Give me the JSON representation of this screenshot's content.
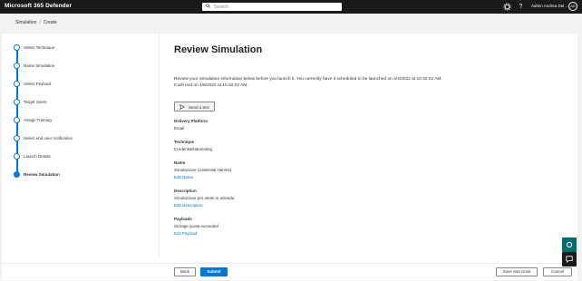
{
  "header": {
    "app_name": "Microsoft 365 Defender",
    "search_placeholder": "Search",
    "user_name": "Admin Andrea Del...",
    "avatar_initials": "AD",
    "icons": [
      "search-icon",
      "gear-icon",
      "help-icon"
    ]
  },
  "breadcrumb": {
    "items": [
      "Simulation",
      "Create"
    ],
    "separator": "/"
  },
  "steps": [
    {
      "label": "Select Technique",
      "state": "completed"
    },
    {
      "label": "Name Simulation",
      "state": "completed"
    },
    {
      "label": "Select Payload",
      "state": "completed"
    },
    {
      "label": "Target Users",
      "state": "completed"
    },
    {
      "label": "Assign Training",
      "state": "completed"
    },
    {
      "label": "Select end user notification",
      "state": "completed"
    },
    {
      "label": "Launch Details",
      "state": "completed"
    },
    {
      "label": "Review Simulation",
      "state": "current"
    }
  ],
  "main": {
    "title": "Review Simulation",
    "intro_line1": "Review your Simulation information below before you launch it. You currently have it scheduled to be launched on 4/4/2022 at 10:32:02 AM.",
    "intro_line2": "It will end on 4/6/2022 at 10:32:02 AM.",
    "send_test_label": "Send a test",
    "fields": {
      "delivery_platform": {
        "heading": "Delivery Platform",
        "value": "Email"
      },
      "technique": {
        "heading": "Technique",
        "value": "CredentialHarvesting"
      },
      "name": {
        "heading": "Name",
        "value": "Simulazione Credential Harvest",
        "edit_label": "Edit Name"
      },
      "description": {
        "heading": "Description",
        "value": "Simulazione per utenti in azienda",
        "edit_label": "Edit Description"
      },
      "payloads": {
        "heading": "Payloads",
        "value": "Storage quota exceeded",
        "edit_label": "Edit Payload"
      }
    }
  },
  "footer": {
    "back_label": "Back",
    "submit_label": "Submit",
    "save_close_label": "Save and close",
    "cancel_label": "Cancel"
  },
  "colors": {
    "accent": "#0078d4",
    "topbar": "#1b1a19",
    "float_teal": "#006e6e"
  }
}
